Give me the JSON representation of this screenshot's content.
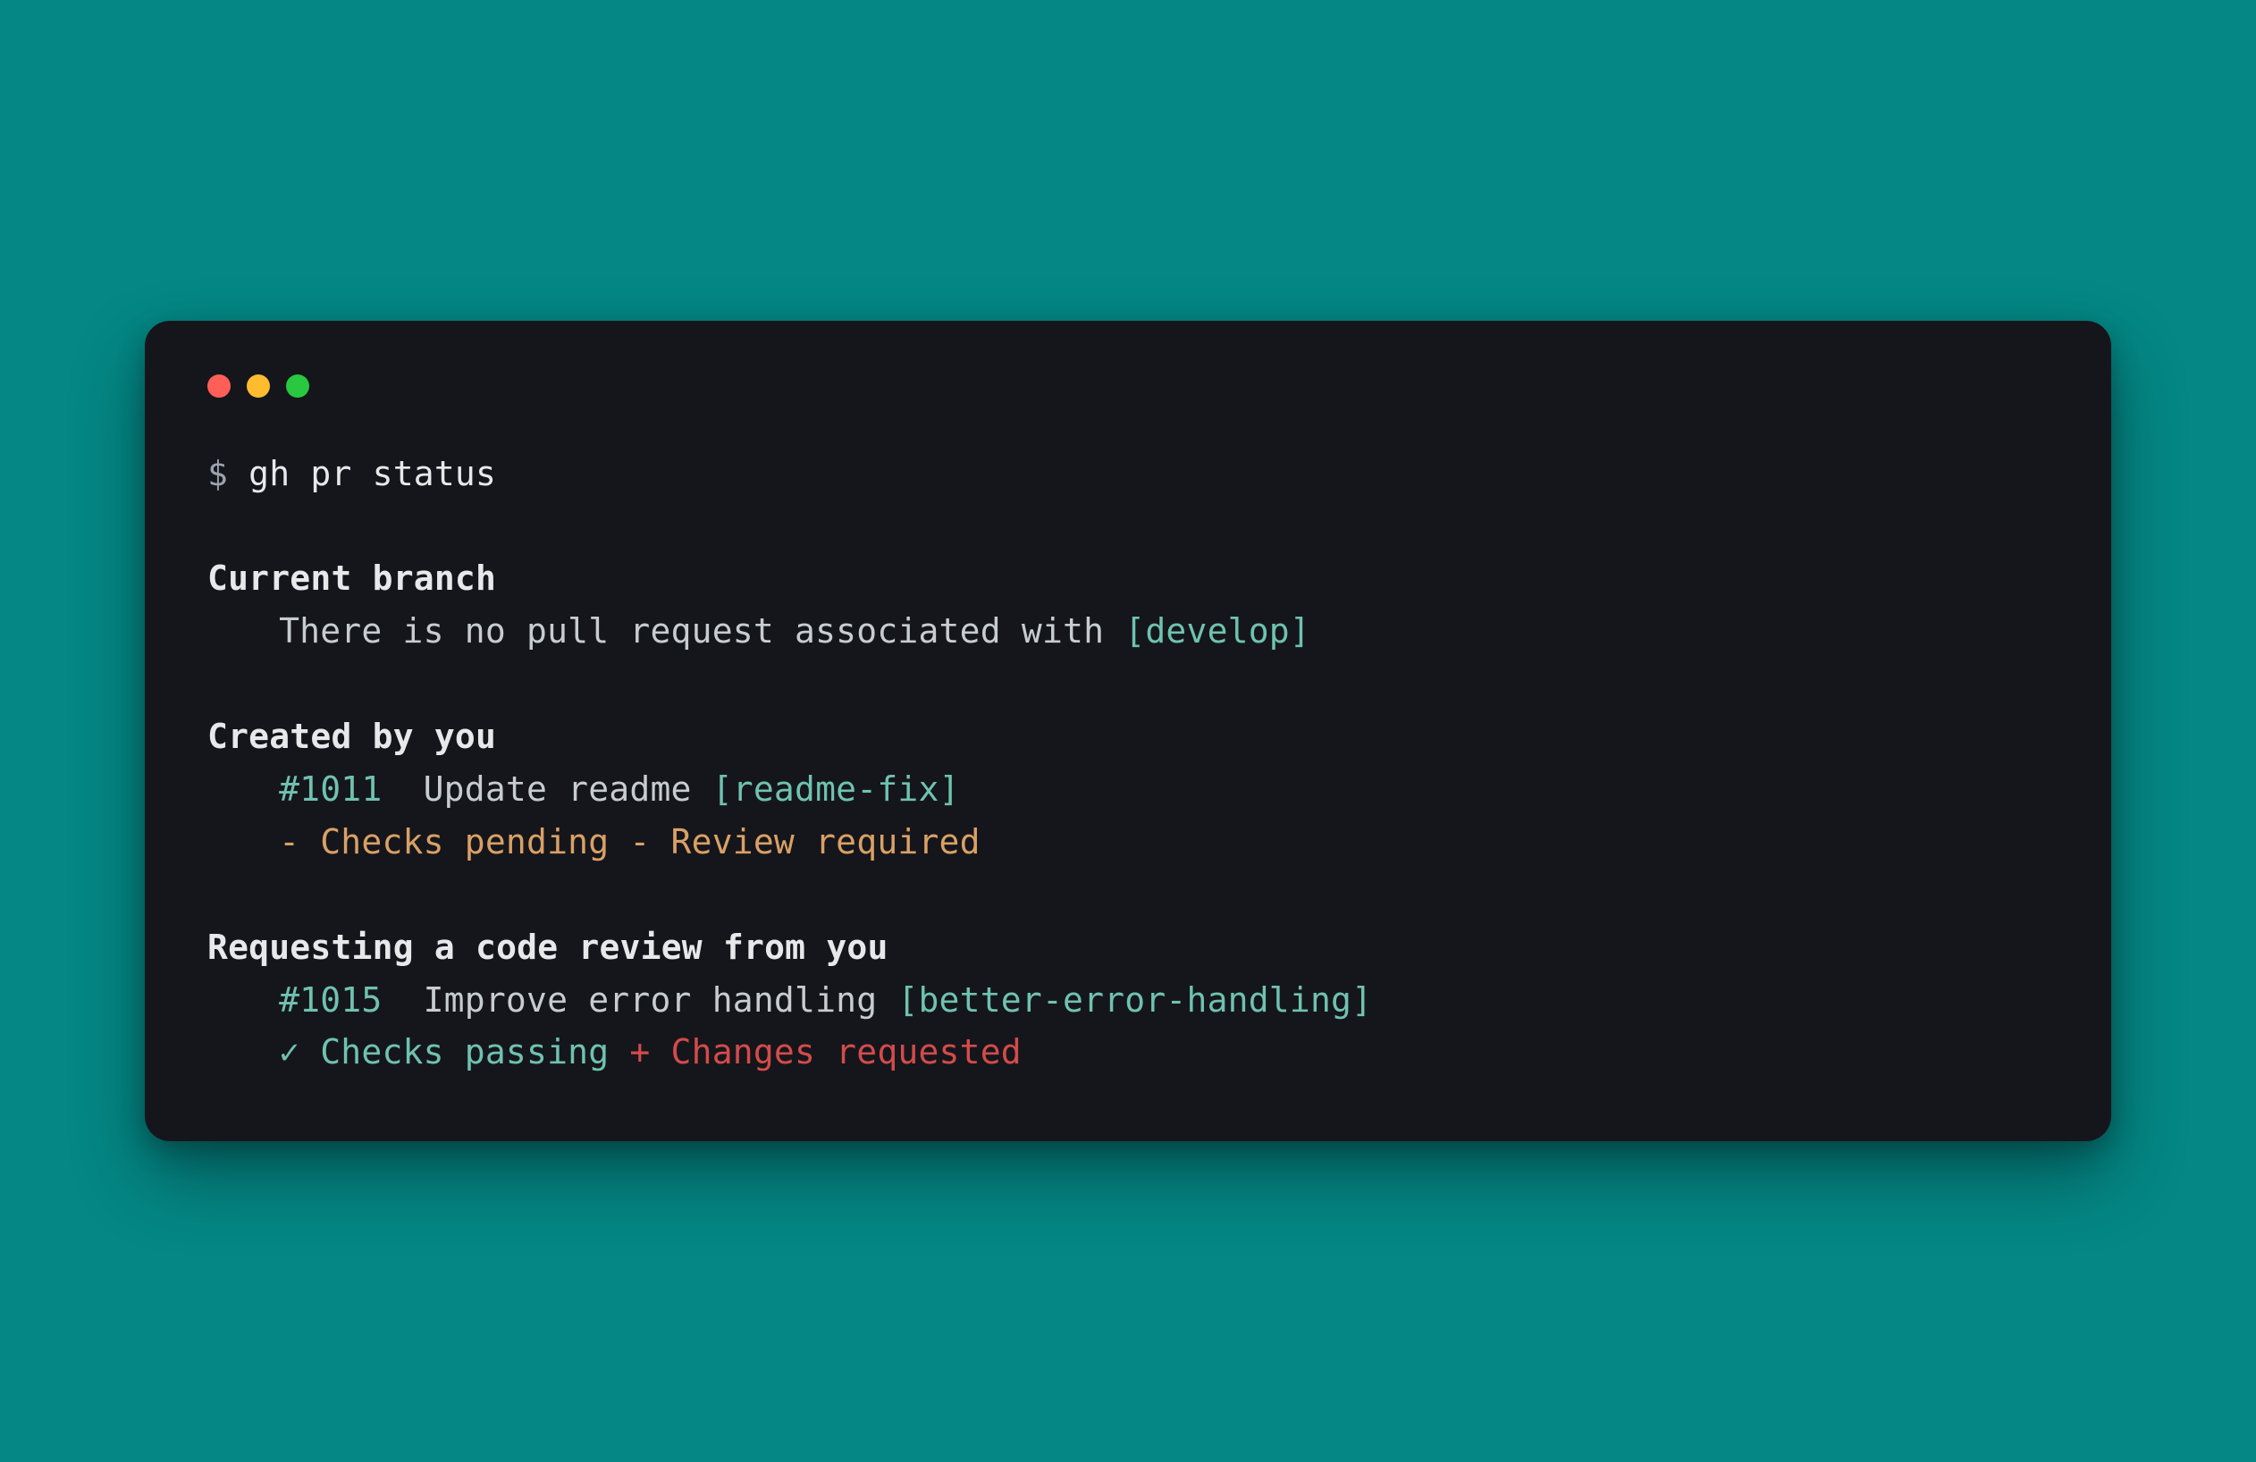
{
  "prompt_symbol": "$",
  "command": "gh pr status",
  "sections": {
    "current_branch": {
      "heading": "Current branch",
      "message_prefix": "There is no pull request associated with ",
      "branch_label": "[develop]"
    },
    "created_by_you": {
      "heading": "Created by you",
      "pr_number": "#1011",
      "pr_title": "Update readme",
      "branch_label": "[readme-fix]",
      "status_line": "- Checks pending - Review required"
    },
    "requesting_review": {
      "heading": "Requesting a code review from you",
      "pr_number": "#1015",
      "pr_title": "Improve error handling",
      "branch_label": "[better-error-handling]",
      "checks_symbol": "✓",
      "checks_text": "Checks passing",
      "changes_symbol": "+",
      "changes_text": "Changes requested"
    }
  }
}
